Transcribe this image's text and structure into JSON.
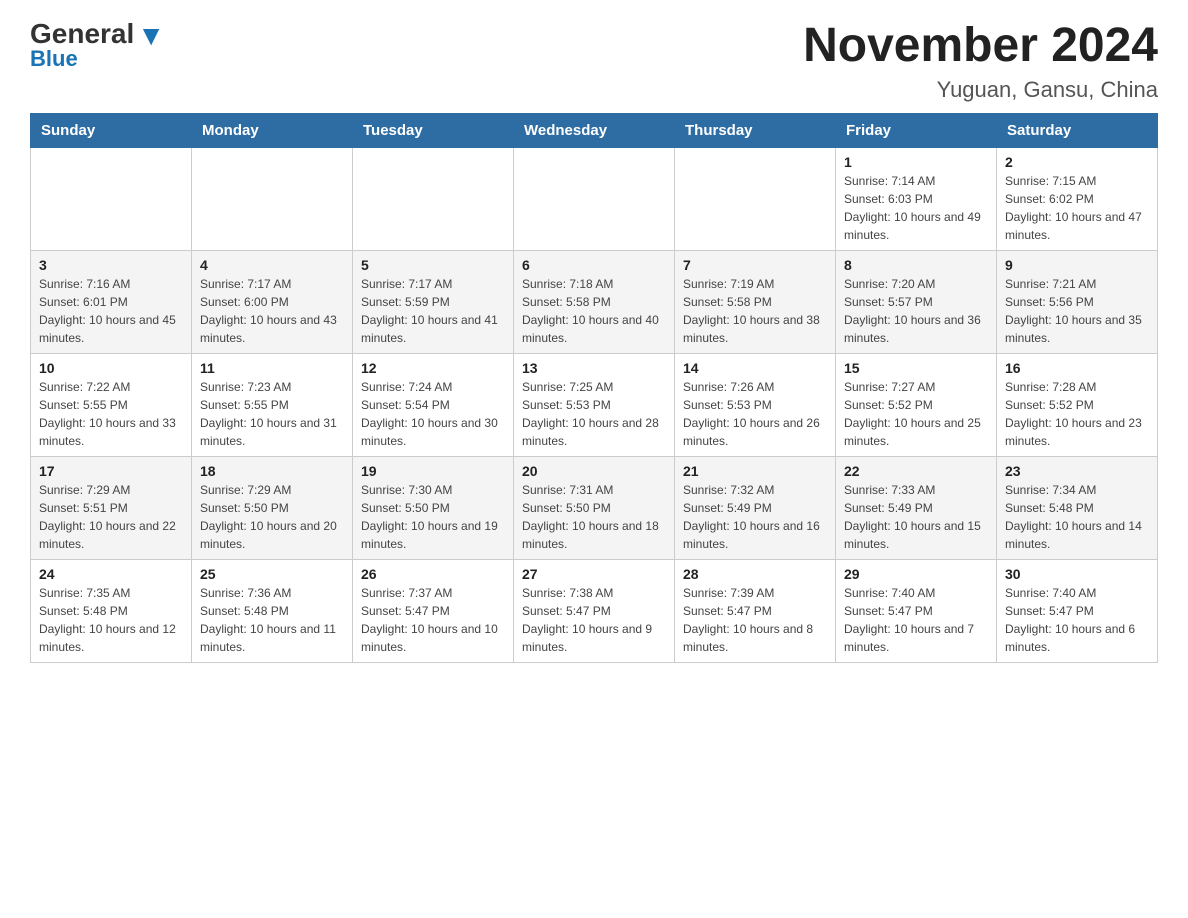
{
  "logo": {
    "general": "General",
    "blue_text": "Blue",
    "tagline": "General Blue"
  },
  "header": {
    "title": "November 2024",
    "location": "Yuguan, Gansu, China"
  },
  "weekdays": [
    "Sunday",
    "Monday",
    "Tuesday",
    "Wednesday",
    "Thursday",
    "Friday",
    "Saturday"
  ],
  "weeks": [
    [
      {
        "day": "",
        "info": ""
      },
      {
        "day": "",
        "info": ""
      },
      {
        "day": "",
        "info": ""
      },
      {
        "day": "",
        "info": ""
      },
      {
        "day": "",
        "info": ""
      },
      {
        "day": "1",
        "info": "Sunrise: 7:14 AM\nSunset: 6:03 PM\nDaylight: 10 hours and 49 minutes."
      },
      {
        "day": "2",
        "info": "Sunrise: 7:15 AM\nSunset: 6:02 PM\nDaylight: 10 hours and 47 minutes."
      }
    ],
    [
      {
        "day": "3",
        "info": "Sunrise: 7:16 AM\nSunset: 6:01 PM\nDaylight: 10 hours and 45 minutes."
      },
      {
        "day": "4",
        "info": "Sunrise: 7:17 AM\nSunset: 6:00 PM\nDaylight: 10 hours and 43 minutes."
      },
      {
        "day": "5",
        "info": "Sunrise: 7:17 AM\nSunset: 5:59 PM\nDaylight: 10 hours and 41 minutes."
      },
      {
        "day": "6",
        "info": "Sunrise: 7:18 AM\nSunset: 5:58 PM\nDaylight: 10 hours and 40 minutes."
      },
      {
        "day": "7",
        "info": "Sunrise: 7:19 AM\nSunset: 5:58 PM\nDaylight: 10 hours and 38 minutes."
      },
      {
        "day": "8",
        "info": "Sunrise: 7:20 AM\nSunset: 5:57 PM\nDaylight: 10 hours and 36 minutes."
      },
      {
        "day": "9",
        "info": "Sunrise: 7:21 AM\nSunset: 5:56 PM\nDaylight: 10 hours and 35 minutes."
      }
    ],
    [
      {
        "day": "10",
        "info": "Sunrise: 7:22 AM\nSunset: 5:55 PM\nDaylight: 10 hours and 33 minutes."
      },
      {
        "day": "11",
        "info": "Sunrise: 7:23 AM\nSunset: 5:55 PM\nDaylight: 10 hours and 31 minutes."
      },
      {
        "day": "12",
        "info": "Sunrise: 7:24 AM\nSunset: 5:54 PM\nDaylight: 10 hours and 30 minutes."
      },
      {
        "day": "13",
        "info": "Sunrise: 7:25 AM\nSunset: 5:53 PM\nDaylight: 10 hours and 28 minutes."
      },
      {
        "day": "14",
        "info": "Sunrise: 7:26 AM\nSunset: 5:53 PM\nDaylight: 10 hours and 26 minutes."
      },
      {
        "day": "15",
        "info": "Sunrise: 7:27 AM\nSunset: 5:52 PM\nDaylight: 10 hours and 25 minutes."
      },
      {
        "day": "16",
        "info": "Sunrise: 7:28 AM\nSunset: 5:52 PM\nDaylight: 10 hours and 23 minutes."
      }
    ],
    [
      {
        "day": "17",
        "info": "Sunrise: 7:29 AM\nSunset: 5:51 PM\nDaylight: 10 hours and 22 minutes."
      },
      {
        "day": "18",
        "info": "Sunrise: 7:29 AM\nSunset: 5:50 PM\nDaylight: 10 hours and 20 minutes."
      },
      {
        "day": "19",
        "info": "Sunrise: 7:30 AM\nSunset: 5:50 PM\nDaylight: 10 hours and 19 minutes."
      },
      {
        "day": "20",
        "info": "Sunrise: 7:31 AM\nSunset: 5:50 PM\nDaylight: 10 hours and 18 minutes."
      },
      {
        "day": "21",
        "info": "Sunrise: 7:32 AM\nSunset: 5:49 PM\nDaylight: 10 hours and 16 minutes."
      },
      {
        "day": "22",
        "info": "Sunrise: 7:33 AM\nSunset: 5:49 PM\nDaylight: 10 hours and 15 minutes."
      },
      {
        "day": "23",
        "info": "Sunrise: 7:34 AM\nSunset: 5:48 PM\nDaylight: 10 hours and 14 minutes."
      }
    ],
    [
      {
        "day": "24",
        "info": "Sunrise: 7:35 AM\nSunset: 5:48 PM\nDaylight: 10 hours and 12 minutes."
      },
      {
        "day": "25",
        "info": "Sunrise: 7:36 AM\nSunset: 5:48 PM\nDaylight: 10 hours and 11 minutes."
      },
      {
        "day": "26",
        "info": "Sunrise: 7:37 AM\nSunset: 5:47 PM\nDaylight: 10 hours and 10 minutes."
      },
      {
        "day": "27",
        "info": "Sunrise: 7:38 AM\nSunset: 5:47 PM\nDaylight: 10 hours and 9 minutes."
      },
      {
        "day": "28",
        "info": "Sunrise: 7:39 AM\nSunset: 5:47 PM\nDaylight: 10 hours and 8 minutes."
      },
      {
        "day": "29",
        "info": "Sunrise: 7:40 AM\nSunset: 5:47 PM\nDaylight: 10 hours and 7 minutes."
      },
      {
        "day": "30",
        "info": "Sunrise: 7:40 AM\nSunset: 5:47 PM\nDaylight: 10 hours and 6 minutes."
      }
    ]
  ]
}
